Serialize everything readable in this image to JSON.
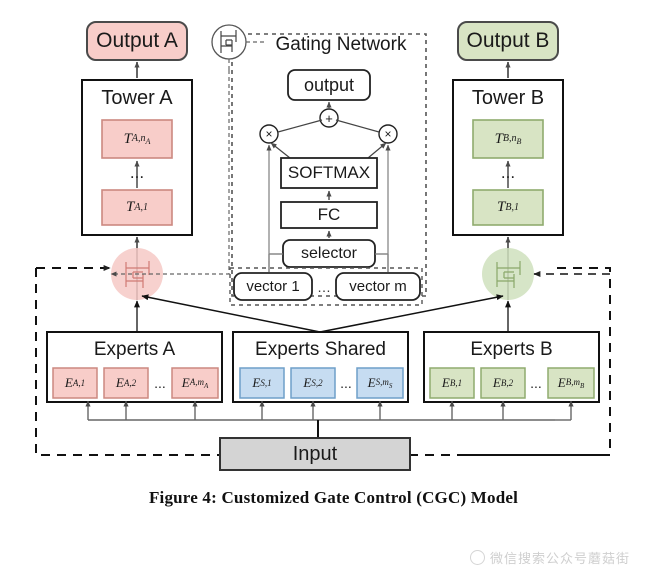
{
  "figure": {
    "caption": "Figure 4: Customized Gate Control (CGC) Model",
    "watermark": "微信搜索公众号蘑菇街"
  },
  "colors": {
    "taskA_fill": "#f8cdc9",
    "taskA_stroke": "#d98f88",
    "taskB_fill": "#d8e4c4",
    "taskB_stroke": "#9ab27a",
    "shared_fill": "#c6dcf1",
    "shared_stroke": "#6f9fc9",
    "input_fill": "#d4d4d4",
    "input_stroke": "#333333",
    "outline": "#1a1a1a",
    "line": "#555555"
  },
  "outputs": {
    "left": {
      "label": "Output A"
    },
    "right": {
      "label": "Output B"
    }
  },
  "towers": {
    "left": {
      "title": "Tower A",
      "top_layer": "T",
      "top_layer_sub": "A,n",
      "top_layer_sub2": "A",
      "ellipsis": "...",
      "bottom_layer": "T",
      "bottom_layer_sub": "A,1"
    },
    "right": {
      "title": "Tower B",
      "top_layer": "T",
      "top_layer_sub": "B,n",
      "top_layer_sub2": "B",
      "ellipsis": "...",
      "bottom_layer": "T",
      "bottom_layer_sub": "B,1"
    }
  },
  "gating_network": {
    "title": "Gating Network",
    "output": "output",
    "plus": "+",
    "mult_left": "×",
    "mult_right": "×",
    "softmax": "SOFTMAX",
    "fc": "FC",
    "selector": "selector",
    "vectors": {
      "first": "vector 1",
      "ellipsis": "…",
      "last": "vector m"
    }
  },
  "experts": {
    "a": {
      "title": "Experts A",
      "items": [
        {
          "sym": "E",
          "sub": "A,1"
        },
        {
          "sym": "E",
          "sub": "A,2"
        },
        {
          "sym": "E",
          "sub": "A,m",
          "sub2": "A"
        }
      ],
      "ellipsis": "..."
    },
    "shared": {
      "title": "Experts Shared",
      "items": [
        {
          "sym": "E",
          "sub": "S,1"
        },
        {
          "sym": "E",
          "sub": "S,2"
        },
        {
          "sym": "E",
          "sub": "S,m",
          "sub2": "S"
        }
      ],
      "ellipsis": "..."
    },
    "b": {
      "title": "Experts B",
      "items": [
        {
          "sym": "E",
          "sub": "B,1"
        },
        {
          "sym": "E",
          "sub": "B,2"
        },
        {
          "sym": "E",
          "sub": "B,m",
          "sub2": "B"
        }
      ],
      "ellipsis": "..."
    }
  },
  "input": {
    "label": "Input"
  },
  "icons": {
    "gate_symbol": "gate-icon",
    "gate_left": "gate-circle-task-a",
    "gate_right": "gate-circle-task-b"
  }
}
